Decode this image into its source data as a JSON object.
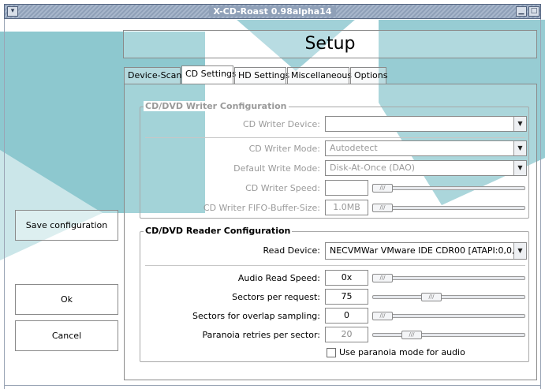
{
  "window": {
    "title": "X-CD-Roast 0.98alpha14",
    "menu_icon": "chevron-down-icon",
    "minimize_icon": "minimize-icon",
    "maximize_icon": "maximize-icon"
  },
  "header": {
    "title": "Setup"
  },
  "tabs": [
    {
      "label": "Device-Scan",
      "active": false
    },
    {
      "label": "CD Settings",
      "active": true
    },
    {
      "label": "HD Settings",
      "active": false
    },
    {
      "label": "Miscellaneous",
      "active": false
    },
    {
      "label": "Options",
      "active": false
    }
  ],
  "writer": {
    "group_title": "CD/DVD Writer Configuration",
    "device_label": "CD Writer Device:",
    "device_value": "",
    "mode_label": "CD Writer Mode:",
    "mode_value": "Autodetect",
    "write_mode_label": "Default Write Mode:",
    "write_mode_value": "Disk-At-Once (DAO)",
    "speed_label": "CD Writer Speed:",
    "speed_value": "",
    "fifo_label": "CD Writer FIFO-Buffer-Size:",
    "fifo_value": "1.0MB",
    "speed_level": 0,
    "fifo_level": 0
  },
  "reader": {
    "group_title": "CD/DVD Reader Configuration",
    "device_label": "Read Device:",
    "device_value": "NECVMWar VMware IDE CDR00 [ATAPI:0,0,0]",
    "audio_speed_label": "Audio Read Speed:",
    "audio_speed_value": "0x",
    "audio_speed_level": 0,
    "sectors_label": "Sectors per request:",
    "sectors_value": "75",
    "sectors_level": 0.37,
    "overlap_label": "Sectors for overlap sampling:",
    "overlap_value": "0",
    "overlap_level": 0,
    "paranoia_label": "Paranoia retries per sector:",
    "paranoia_value": "20",
    "paranoia_level": 0.22,
    "paranoia_mode_label": "Use paranoia mode for audio",
    "paranoia_mode_checked": false
  },
  "buttons": {
    "save": "Save configuration",
    "ok": "Ok",
    "cancel": "Cancel"
  },
  "colors": {
    "accent": "#2f9aa8",
    "titlebar": "#8fa0b8"
  }
}
